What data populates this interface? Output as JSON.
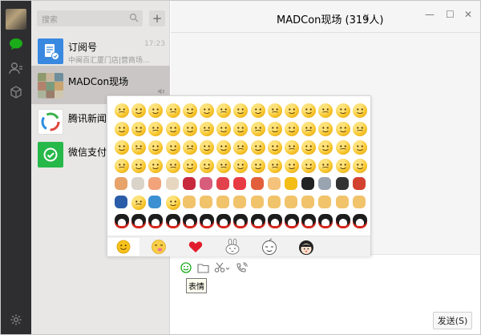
{
  "search": {
    "placeholder": "搜索"
  },
  "add_label": "+",
  "conversations": [
    {
      "name": "订阅号",
      "sub": "中闽百汇厦门店|营商场...",
      "time": "17:23"
    },
    {
      "name": "MADCon现场",
      "sub": "",
      "time": ""
    },
    {
      "name": "腾讯新闻",
      "sub": "",
      "time": ""
    },
    {
      "name": "微信支付",
      "sub": "",
      "time": ""
    }
  ],
  "chat": {
    "title": "MADCon现场 (319人)",
    "chevron": "∨"
  },
  "window": {
    "minimize": "—",
    "maximize": "☐",
    "close": "✕"
  },
  "toolbar": {
    "tooltip": "表情",
    "send_label": "发送(S)"
  },
  "emoji_panel": {
    "rows": 7,
    "cols": 15,
    "tabs": [
      "default-emoji",
      "stickers",
      "favorites",
      "rabbit",
      "onion-head",
      "doll"
    ]
  },
  "colors": {
    "rail": "#2e2e31",
    "accent_green": "#1aad19",
    "list_bg": "#e8e7e6",
    "selected": "#c9c6c5"
  }
}
